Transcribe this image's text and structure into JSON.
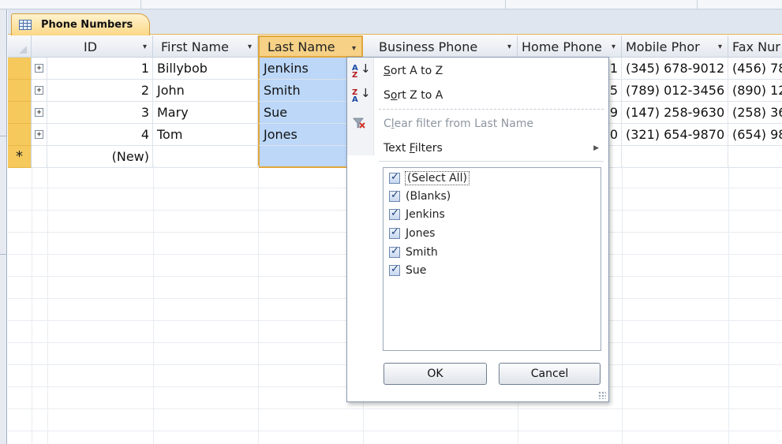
{
  "tab": {
    "title": "Phone Numbers"
  },
  "columns": [
    {
      "label": "ID"
    },
    {
      "label": "First Name"
    },
    {
      "label": "Last Name"
    },
    {
      "label": "Business Phone"
    },
    {
      "label": "Home Phone"
    },
    {
      "label": "Mobile Phor"
    },
    {
      "label": "Fax Nur"
    }
  ],
  "rows": [
    {
      "id": "1",
      "first": "Billybob",
      "last": "Jenkins",
      "home_tail": "1",
      "mobile": "(345) 678-9012",
      "fax": "(456) 78"
    },
    {
      "id": "2",
      "first": "John",
      "last": "Smith",
      "home_tail": "5",
      "mobile": "(789) 012-3456",
      "fax": "(890) 12"
    },
    {
      "id": "3",
      "first": "Mary",
      "last": "Sue",
      "home_tail": "9",
      "mobile": "(147) 258-9630",
      "fax": "(258) 36"
    },
    {
      "id": "4",
      "first": "Tom",
      "last": "Jones",
      "home_tail": "0",
      "mobile": "(321) 654-9870",
      "fax": "(654) 98"
    }
  ],
  "new_row": {
    "label": "(New)",
    "marker": "*"
  },
  "menu": {
    "sort_az": {
      "pre": "",
      "key": "S",
      "post": "ort A to Z"
    },
    "sort_za": {
      "pre": "S",
      "key": "o",
      "post": "rt Z to A"
    },
    "clear_filter": {
      "pre": "C",
      "key": "l",
      "post": "ear filter from Last Name"
    },
    "text_filters": {
      "pre": "Text ",
      "key": "F",
      "post": "ilters"
    },
    "filter_values": [
      "(Select All)",
      "(Blanks)",
      "Jenkins",
      "Jones",
      "Smith",
      "Sue"
    ],
    "ok": "OK",
    "cancel": "Cancel"
  },
  "colors": {
    "selection": "#bcd7f8",
    "accent": "#e1a73c",
    "row_selector": "#f5c95b"
  }
}
